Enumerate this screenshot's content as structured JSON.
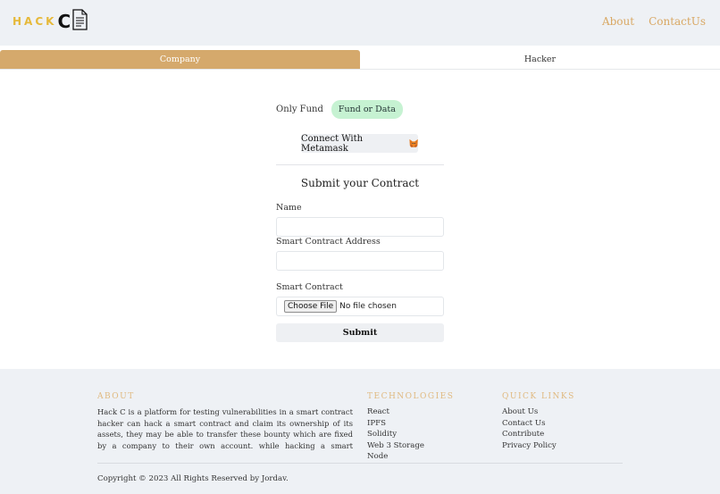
{
  "header": {
    "logo_text": "HACK",
    "logo_c": "C",
    "nav": {
      "about": "About",
      "contact": "ContactUs"
    }
  },
  "tabs": {
    "company": "Company",
    "hacker": "Hacker"
  },
  "toggle": {
    "only_fund": "Only Fund",
    "fund_or_data": "Fund or Data"
  },
  "metamask": {
    "label": "Connect With Metamask"
  },
  "form": {
    "title": "Submit your Contract",
    "name_label": "Name",
    "address_label": "Smart Contract Address",
    "contract_label": "Smart Contract",
    "choose_file": "Choose File",
    "no_file": "No file chosen",
    "submit": "Submit"
  },
  "footer": {
    "about_heading": "ABOUT",
    "about_text": "Hack C is a platform for testing vulnerabilities in a smart contract hacker can hack a smart contract and claim its ownership of its assets, they may be able to transfer these bounty which are fixed by a company to their own account. while hacking a smart contract and claiming ownership be careful",
    "tech_heading": "TECHNOLOGIES",
    "tech_items": [
      "React",
      "IPFS",
      "Solidity",
      "Web 3 Storage",
      "Node"
    ],
    "links_heading": "QUICK LINKS",
    "link_items": [
      "About Us",
      "Contact Us",
      "Contribute",
      "Privacy Policy"
    ],
    "copyright": "Copyright © 2023 All Rights Reserved by Jordav."
  },
  "colors": {
    "accent": "#d5a96c",
    "logo_yellow": "#e6b93a",
    "pill_green": "#c6f2d2",
    "footer_bg": "#eef1f5"
  }
}
